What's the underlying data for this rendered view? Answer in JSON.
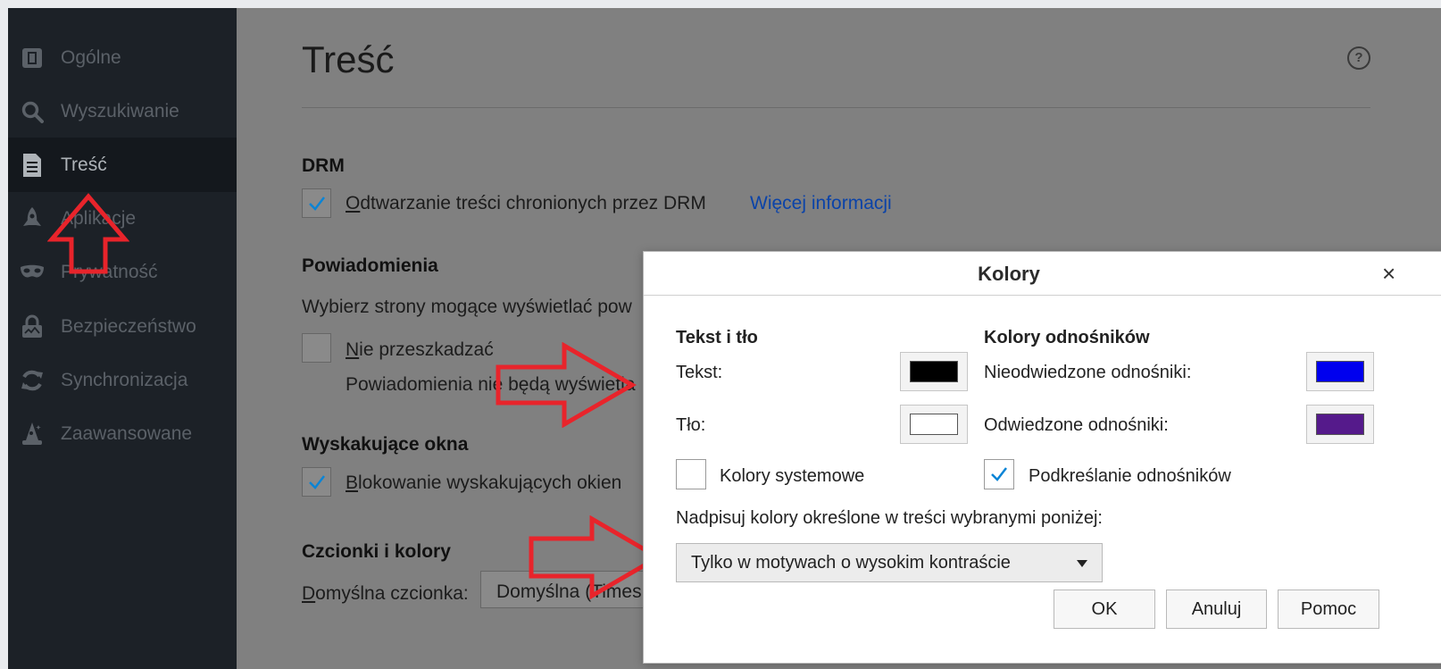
{
  "sidebar": {
    "items": [
      {
        "label": "Ogólne",
        "icon": "general-icon"
      },
      {
        "label": "Wyszukiwanie",
        "icon": "search-icon"
      },
      {
        "label": "Treść",
        "icon": "content-document-icon",
        "active": true
      },
      {
        "label": "Aplikacje",
        "icon": "rocket-icon"
      },
      {
        "label": "Prywatność",
        "icon": "mask-icon"
      },
      {
        "label": "Bezpieczeństwo",
        "icon": "lock-icon"
      },
      {
        "label": "Synchronizacja",
        "icon": "sync-icon"
      },
      {
        "label": "Zaawansowane",
        "icon": "wizard-icon"
      }
    ]
  },
  "main": {
    "title": "Treść",
    "drm": {
      "heading": "DRM",
      "checkbox_first": "O",
      "checkbox_rest": "dtwarzanie treści chronionych przez DRM",
      "checked": true,
      "link": "Więcej informacji"
    },
    "notifications": {
      "heading": "Powiadomienia",
      "description": "Wybierz strony mogące wyświetlać pow",
      "dnd_first": "N",
      "dnd_rest": "ie przeszkadzać",
      "dnd_checked": false,
      "dnd_note": "Powiadomienia nie będą wyświetla"
    },
    "popups": {
      "heading": "Wyskakujące okna",
      "checkbox_first": "B",
      "checkbox_rest": "lokowanie wyskakujących okien",
      "checked": true
    },
    "fonts": {
      "heading": "Czcionki i kolory",
      "label_first": "D",
      "label_rest": "omyślna czcionka:",
      "value": "Domyślna (Times"
    }
  },
  "dialog": {
    "title": "Kolory",
    "close": "×",
    "text_bg": {
      "heading": "Tekst i tło",
      "text_label": "Tekst:",
      "text_color": "#000000",
      "bg_label": "Tło:",
      "bg_color": "#ffffff"
    },
    "links": {
      "heading": "Kolory odnośników",
      "unvisited_label": "Nieodwiedzone odnośniki:",
      "unvisited_color": "#0000ee",
      "visited_label": "Odwiedzone odnośniki:",
      "visited_color": "#551a8b"
    },
    "system_colors": {
      "label": "Kolory systemowe",
      "checked": false
    },
    "underline_links": {
      "label": "Podkreślanie odnośników",
      "checked": true
    },
    "override_label": "Nadpisuj kolory określone w treści wybranymi poniżej:",
    "override_value": "Tylko w motywach o wysokim kontraście",
    "buttons": {
      "ok": "OK",
      "cancel": "Anuluj",
      "help": "Pomoc"
    }
  },
  "colors": {
    "annotation_arrow": "#e8242b",
    "checkmark": "#0a84d6",
    "link": "#0b43a8"
  }
}
